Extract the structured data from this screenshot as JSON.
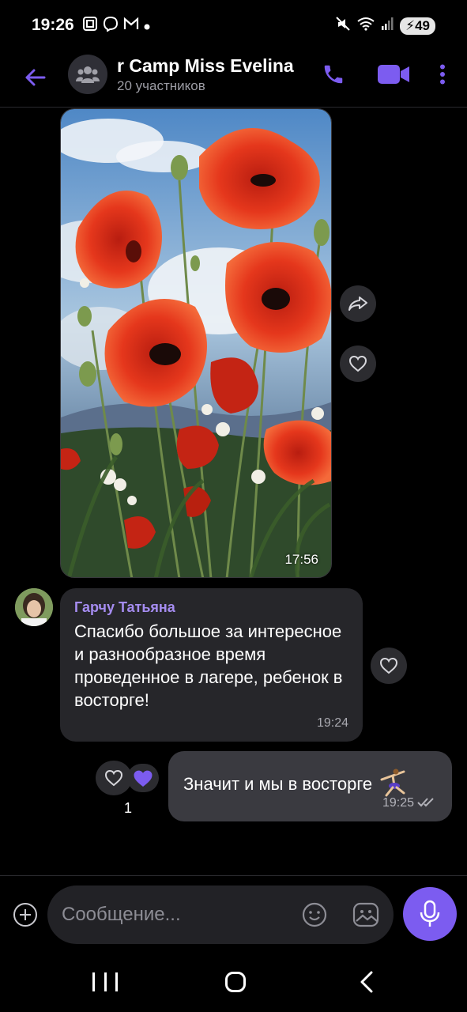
{
  "status_bar": {
    "time": "19:26",
    "battery": "49",
    "left_icons": [
      "screenshot-icon",
      "viber-icon",
      "gmail-icon",
      "dot-icon"
    ],
    "right_icons": [
      "mute-icon",
      "wifi-icon",
      "signal-icon"
    ]
  },
  "header": {
    "title": "r Camp Miss Evelina",
    "subtitle": "20 участников",
    "accent": "#7c5cf0"
  },
  "messages": {
    "image": {
      "time": "17:56"
    },
    "incoming": {
      "sender": "Гарчу Татьяна",
      "text": "Спасибо большое за интересное и разнообразное время проведенное в лагере, ребенок в восторге!",
      "time": "19:24"
    },
    "outgoing": {
      "text": "Значит  и мы в восторге",
      "time": "19:25",
      "reaction_count": "1"
    }
  },
  "composer": {
    "placeholder": "Сообщение..."
  },
  "colors": {
    "background": "#000000",
    "incoming_bubble": "#26262a",
    "outgoing_bubble": "#3a3a40",
    "sender_name": "#a58cf0"
  }
}
